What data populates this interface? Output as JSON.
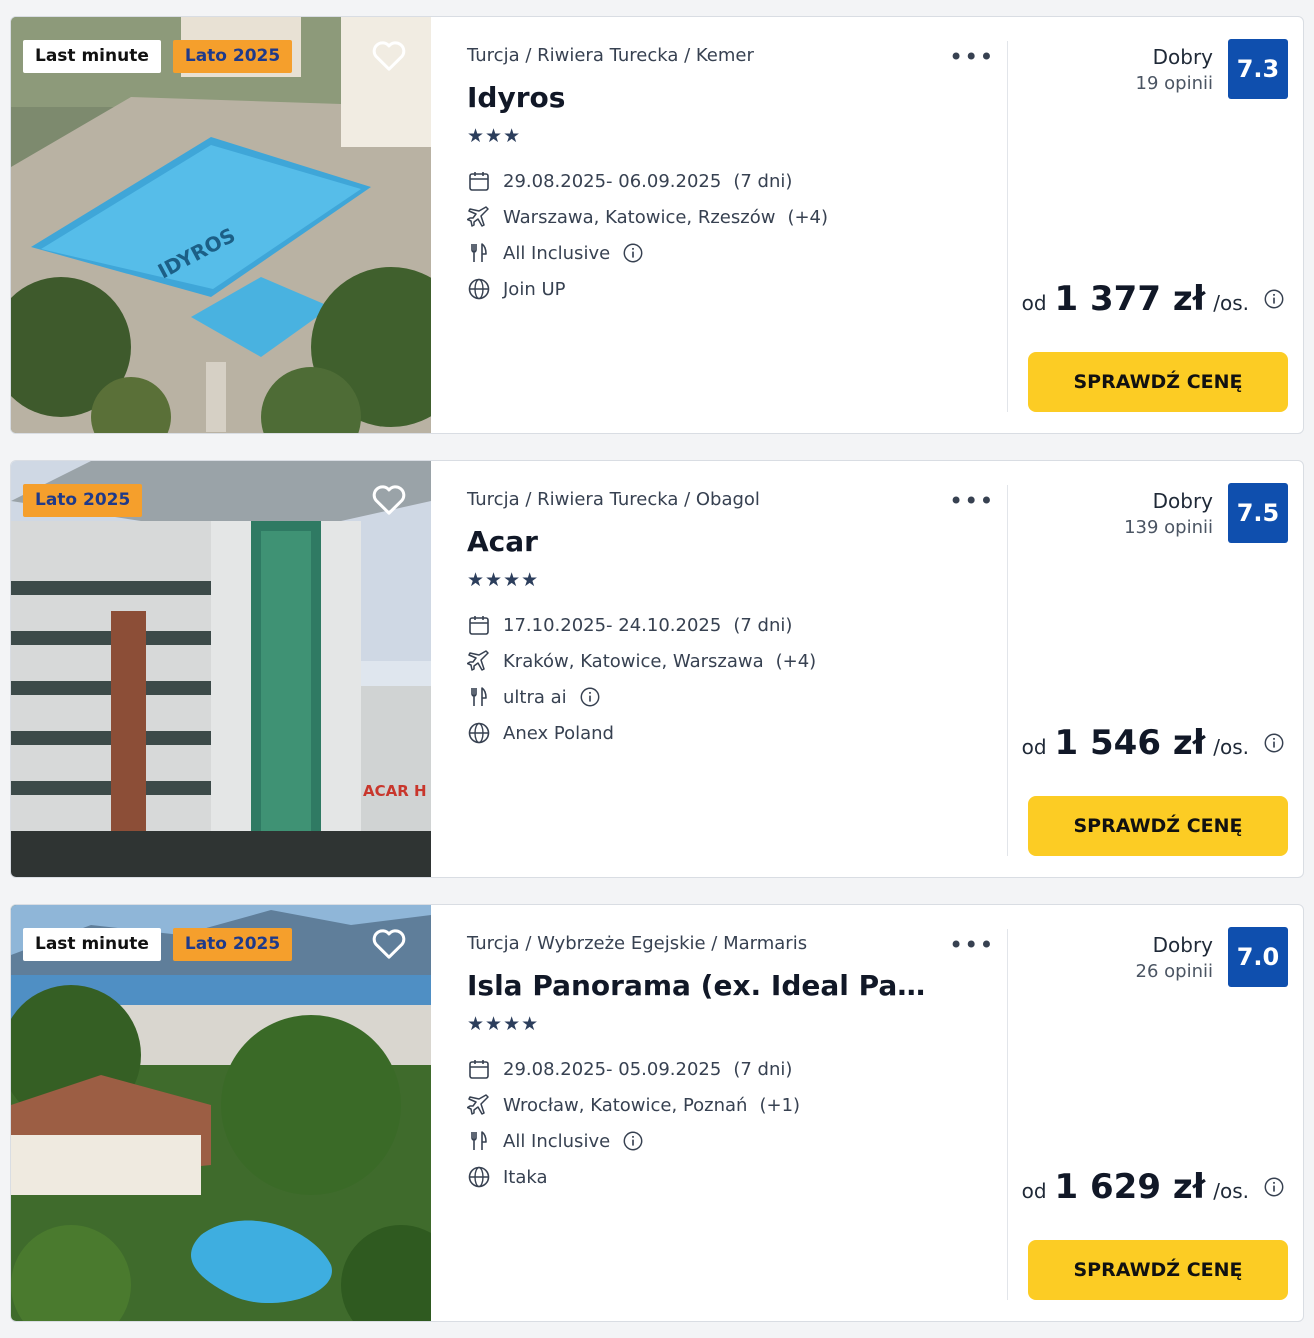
{
  "results": [
    {
      "badges": [
        "Last minute",
        "Lato 2025"
      ],
      "breadcrumb": "Turcja / Riwiera Turecka / Kemer",
      "name": "Idyros",
      "stars": "★★★",
      "dates": "29.08.2025- 06.09.2025",
      "duration": "(7 dni)",
      "departure": "Warszawa, Katowice, Rzeszów",
      "departure_more": "(+4)",
      "board": "All Inclusive",
      "operator": "Join UP",
      "rating_label": "Dobry",
      "reviews": "19 opinii",
      "score": "7.3",
      "price_prefix": "od",
      "price": "1 377 zł",
      "price_suffix": "/os.",
      "cta": "SPRAWDŹ CENĘ",
      "photo_text": "IDYROS"
    },
    {
      "badges": [
        "Lato 2025"
      ],
      "breadcrumb": "Turcja / Riwiera Turecka / Obagol",
      "name": "Acar",
      "stars": "★★★★",
      "dates": "17.10.2025- 24.10.2025",
      "duration": "(7 dni)",
      "departure": "Kraków, Katowice, Warszawa",
      "departure_more": "(+4)",
      "board": "ultra ai",
      "operator": "Anex Poland",
      "rating_label": "Dobry",
      "reviews": "139 opinii",
      "score": "7.5",
      "price_prefix": "od",
      "price": "1 546 zł",
      "price_suffix": "/os.",
      "cta": "SPRAWDŹ CENĘ",
      "photo_text": "ACAR H"
    },
    {
      "badges": [
        "Last minute",
        "Lato 2025"
      ],
      "breadcrumb": "Turcja / Wybrzeże Egejskie / Marmaris",
      "name": "Isla Panorama (ex. Ideal Panorama)",
      "stars": "★★★★",
      "dates": "29.08.2025- 05.09.2025",
      "duration": "(7 dni)",
      "departure": "Wrocław, Katowice, Poznań",
      "departure_more": "(+1)",
      "board": "All Inclusive",
      "operator": "Itaka",
      "rating_label": "Dobry",
      "reviews": "26 opinii",
      "score": "7.0",
      "price_prefix": "od",
      "price": "1 629 zł",
      "price_suffix": "/os.",
      "cta": "SPRAWDŹ CENĘ",
      "photo_text": ""
    }
  ],
  "icons": {
    "heart": "heart-icon",
    "more": "more-dots-icon",
    "calendar": "calendar-icon",
    "plane": "plane-icon",
    "board": "cutlery-icon",
    "operator": "globe-icon",
    "info": "info-icon"
  },
  "colors": {
    "score_bg": "#0f4fae",
    "cta_bg": "#fccc24",
    "badge_orange": "#f59f2c",
    "badge_orange_text": "#1f3a8a",
    "stars": "#2c3e5c"
  }
}
